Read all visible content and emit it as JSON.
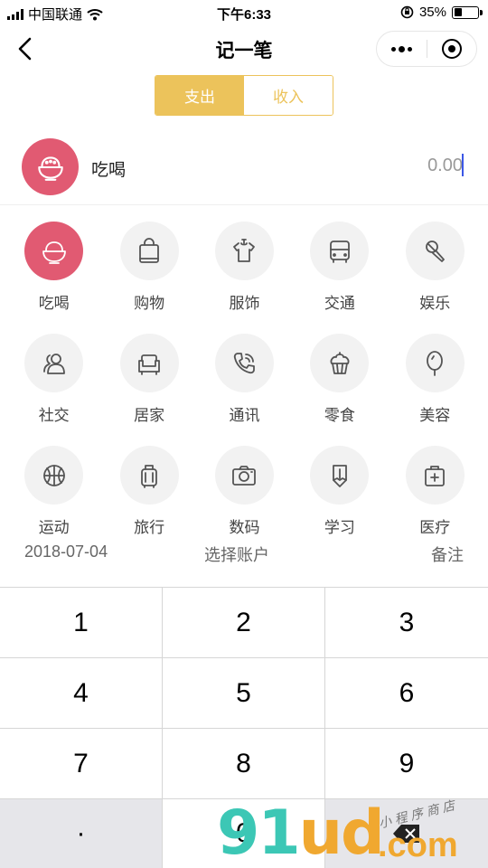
{
  "status_bar": {
    "carrier": "中国联通",
    "time": "下午6:33",
    "battery_percent": "35%",
    "battery_level": 0.35
  },
  "nav": {
    "title": "记一笔"
  },
  "tabs": {
    "expense": "支出",
    "income": "收入",
    "active": "expense"
  },
  "selected": {
    "label": "吃喝",
    "amount": "0.00",
    "color": "#e15a72"
  },
  "categories": [
    {
      "label": "吃喝",
      "icon": "bowl-icon"
    },
    {
      "label": "购物",
      "icon": "shopping-bag-icon"
    },
    {
      "label": "服饰",
      "icon": "shirt-icon"
    },
    {
      "label": "交通",
      "icon": "bus-icon"
    },
    {
      "label": "娱乐",
      "icon": "microphone-icon"
    },
    {
      "label": "社交",
      "icon": "people-icon"
    },
    {
      "label": "居家",
      "icon": "sofa-icon"
    },
    {
      "label": "通讯",
      "icon": "phone-icon"
    },
    {
      "label": "零食",
      "icon": "cupcake-icon"
    },
    {
      "label": "美容",
      "icon": "mirror-icon"
    },
    {
      "label": "运动",
      "icon": "basketball-icon"
    },
    {
      "label": "旅行",
      "icon": "luggage-icon"
    },
    {
      "label": "数码",
      "icon": "camera-icon"
    },
    {
      "label": "学习",
      "icon": "pencil-icon"
    },
    {
      "label": "医疗",
      "icon": "medical-kit-icon"
    }
  ],
  "info": {
    "date": "2018-07-04",
    "account": "选择账户",
    "note": "备注"
  },
  "keypad": [
    "1",
    "2",
    "3",
    "4",
    "5",
    "6",
    "7",
    "8",
    "9",
    "·",
    "0",
    ""
  ],
  "watermark": {
    "main": "91ud",
    "suffix": ".com",
    "small": "小程序商店"
  },
  "colors": {
    "accent": "#ecc35b",
    "selected_category": "#e15a72",
    "caret": "#3b57e6"
  }
}
